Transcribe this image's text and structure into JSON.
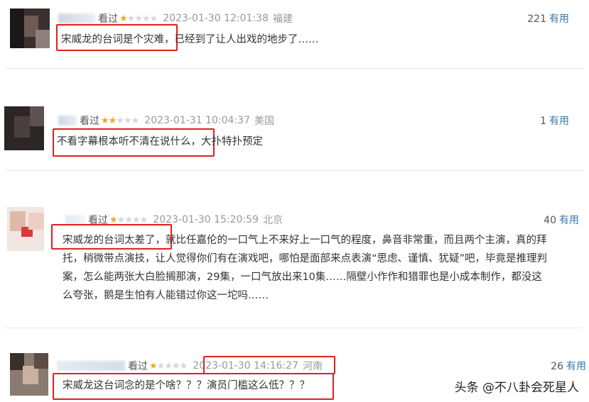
{
  "reviews": [
    {
      "watched": "看过",
      "rating": 1,
      "datetime": "2023-01-30 12:01:38",
      "location": "福建",
      "useful_count": "221",
      "useful_label": "有用",
      "highlight": "宋威龙的台词是个灾难，",
      "rest": "已经到了让人出戏的地步了……"
    },
    {
      "watched": "看过",
      "rating": 2,
      "datetime": "2023-01-31 10:04:37",
      "location": "美国",
      "useful_count": "1",
      "useful_label": "有用",
      "highlight": "不看字幕根本听不清在说什么，",
      "rest": "大扑特扑预定"
    },
    {
      "watched": "看过",
      "rating": 1,
      "datetime": "2023-01-30 15:20:59",
      "location": "北京",
      "useful_count": "40",
      "useful_label": "有用",
      "highlight": "宋威龙的台词太差了，",
      "line1_rest": "就比任嘉伦的一口气上不来好上一口气的程度，鼻音非常重，而且两个主演，真的拜",
      "line2": "托，稍微带点演技，让人觉得你们有在演戏吧，哪怕是面部来点表演“思虑、谨慎、犹疑”吧，毕竟是推理判",
      "line3": "案，怎么能两张大白脸搁那演，29集，一口气放出来10集……隔壁小作作和猎罪也是小成本制作，都没这",
      "line4": "么夸张，鹅是生怕有人能错过你这一坨吗……"
    },
    {
      "watched": "看过",
      "rating": 1,
      "datetime": "2023-01-30 14:16:27",
      "location": "河南",
      "useful_count": "26",
      "useful_label": "有用",
      "highlight": "宋威龙这台词念的是个啥？？？演员门槛这么低？？？",
      "rest": ""
    }
  ],
  "watermark": "头条 @不八卦会死星人",
  "colors": {
    "star": "#f5a623",
    "highlight_box": "#e02020",
    "useful_label": "#3377aa"
  }
}
